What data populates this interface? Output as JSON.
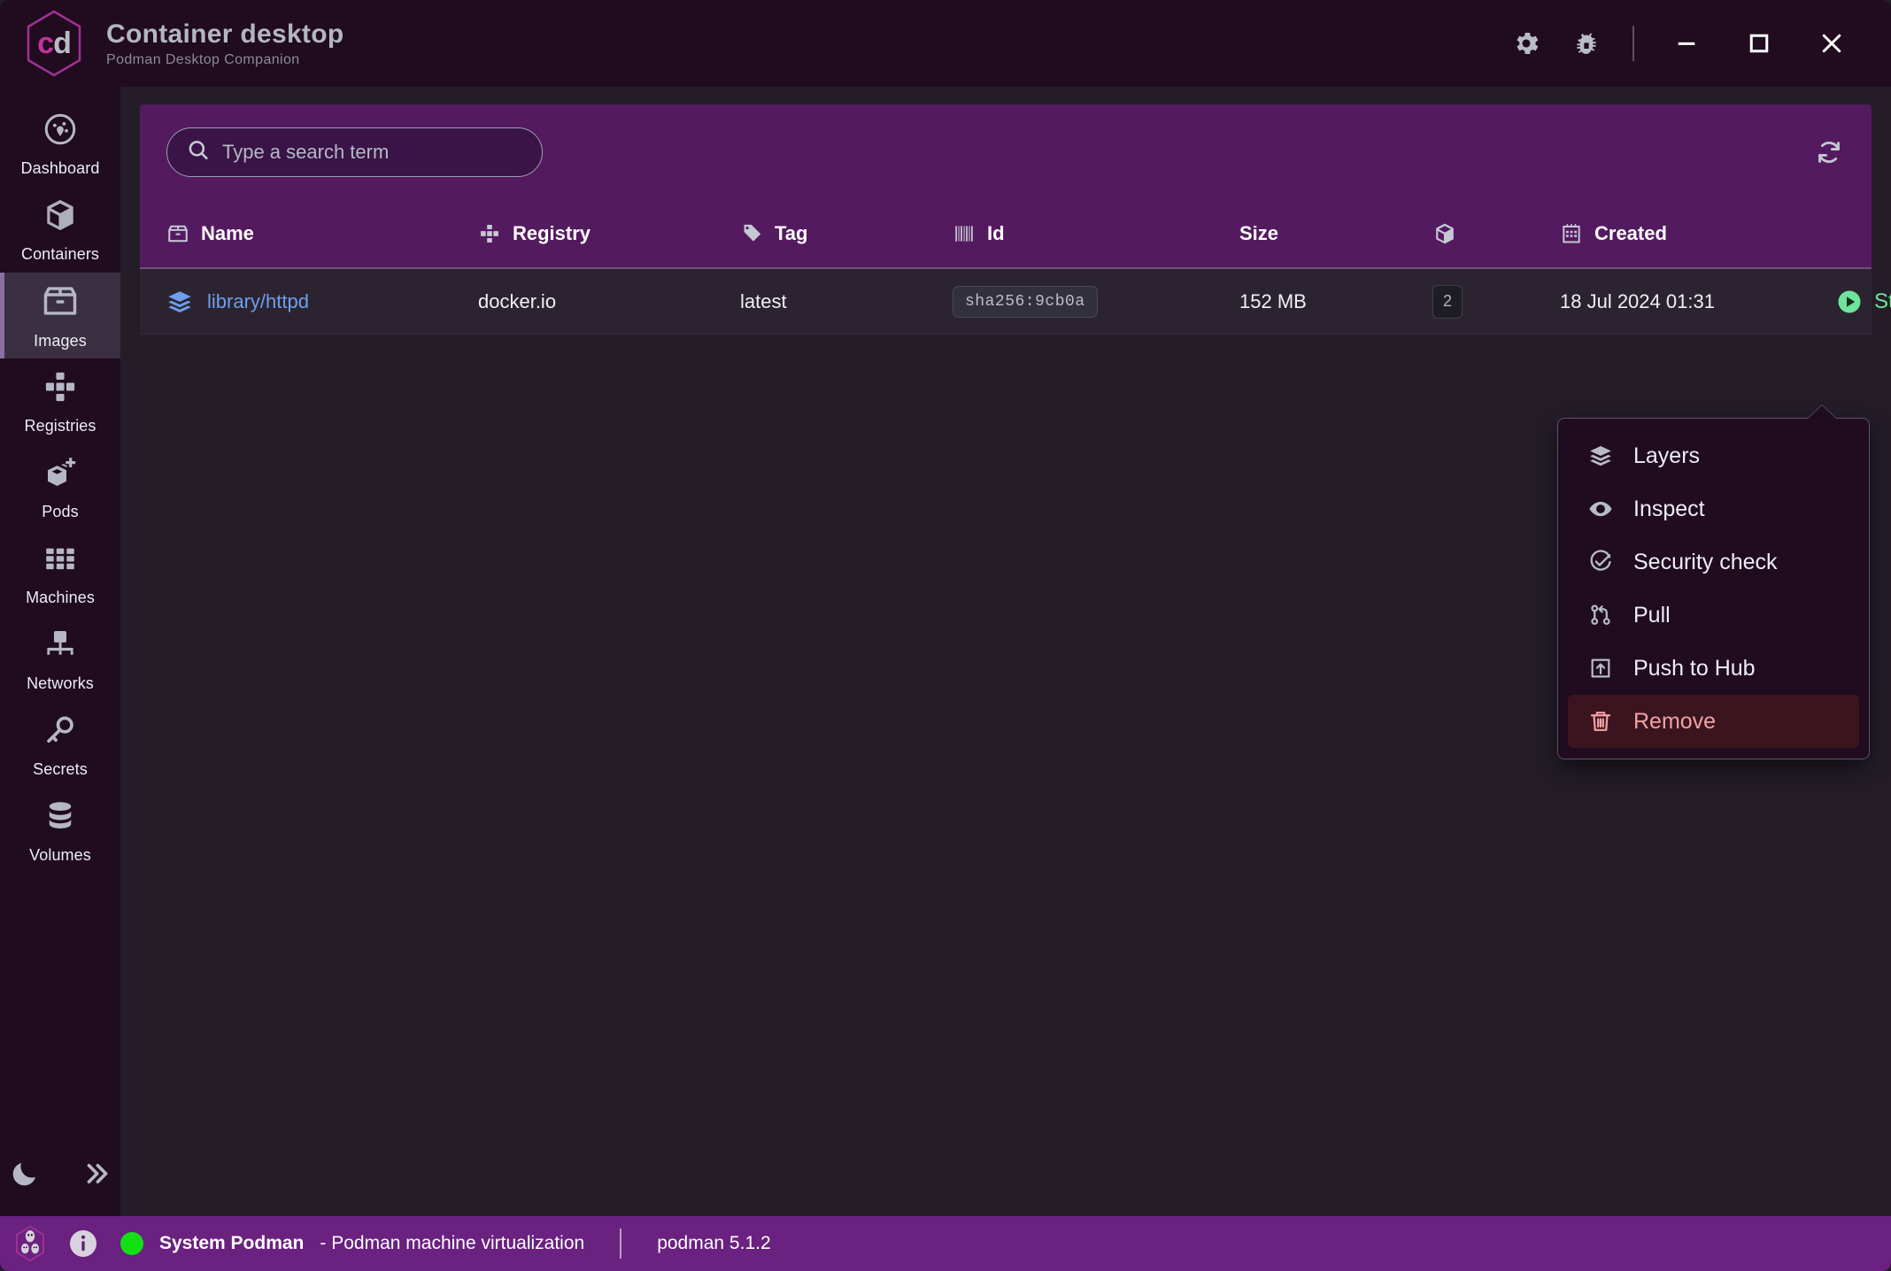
{
  "titlebar": {
    "logo_c": "c",
    "logo_d": "d",
    "title": "Container desktop",
    "subtitle": "Podman Desktop Companion",
    "buttons": [
      {
        "name": "settings",
        "icon": "gear-icon"
      },
      {
        "name": "troubleshoot",
        "icon": "bug-icon"
      }
    ],
    "window_controls": [
      {
        "name": "minimize",
        "icon": "minimize-icon"
      },
      {
        "name": "maximize",
        "icon": "maximize-icon"
      },
      {
        "name": "close",
        "icon": "close-icon"
      }
    ]
  },
  "sidebar": {
    "items": [
      {
        "label": "Dashboard",
        "icon": "gauge-icon",
        "active": false
      },
      {
        "label": "Containers",
        "icon": "cube-icon",
        "active": false
      },
      {
        "label": "Images",
        "icon": "box-icon",
        "active": true
      },
      {
        "label": "Registries",
        "icon": "registry-icon",
        "active": false
      },
      {
        "label": "Pods",
        "icon": "pods-icon",
        "active": false
      },
      {
        "label": "Machines",
        "icon": "machines-icon",
        "active": false
      },
      {
        "label": "Networks",
        "icon": "network-icon",
        "active": false
      },
      {
        "label": "Secrets",
        "icon": "key-icon",
        "active": false
      },
      {
        "label": "Volumes",
        "icon": "database-icon",
        "active": false
      }
    ],
    "bottom": [
      {
        "name": "theme-toggle",
        "icon": "moon-icon"
      },
      {
        "name": "expand-sidebar",
        "icon": "double-chevron-right-icon"
      }
    ]
  },
  "search": {
    "placeholder": "Type a search term",
    "value": "",
    "icon": "search-icon"
  },
  "toolbar": {
    "refresh_icon": "refresh-icon"
  },
  "table": {
    "columns": [
      {
        "label": "Name",
        "icon": "box-icon"
      },
      {
        "label": "Registry",
        "icon": "registry-icon"
      },
      {
        "label": "Tag",
        "icon": "tag-icon"
      },
      {
        "label": "Id",
        "icon": "barcode-icon"
      },
      {
        "label": "Size",
        "icon": ""
      },
      {
        "label": "",
        "icon": "cube-icon"
      },
      {
        "label": "Created",
        "icon": "calendar-icon"
      }
    ],
    "rows": [
      {
        "name": "library/httpd",
        "name_icon": "layers-icon",
        "registry": "docker.io",
        "tag": "latest",
        "id": "sha256:9cb0a",
        "size": "152 MB",
        "count": "2",
        "created": "18 Jul 2024 01:31",
        "start_label": "Start",
        "start_icon": "play-icon",
        "kebab_icon": "kebab-icon"
      }
    ]
  },
  "dropdown": {
    "items": [
      {
        "label": "Layers",
        "icon": "layers-icon",
        "danger": false
      },
      {
        "label": "Inspect",
        "icon": "eye-icon",
        "danger": false
      },
      {
        "label": "Security check",
        "icon": "shield-check-icon",
        "danger": false
      },
      {
        "label": "Pull",
        "icon": "git-pull-icon",
        "danger": false
      },
      {
        "label": "Push to Hub",
        "icon": "push-icon",
        "danger": false
      },
      {
        "label": "Remove",
        "icon": "trash-icon",
        "danger": true
      }
    ]
  },
  "statusbar": {
    "podman_logo_icon": "podman-logo-icon",
    "info_icon": "info-icon",
    "connection_name": "System Podman",
    "connection_desc": "- Podman machine virtualization",
    "version": "podman 5.1.2",
    "status_color": "#12e012"
  },
  "colors": {
    "accent_purple": "#541a60",
    "status_purple": "#6a2180",
    "sidebar_bg": "#200b1f",
    "content_bg": "#241d28",
    "row_bg": "#2b2430",
    "link_blue": "#6f9ef0",
    "start_green": "#6ee59a",
    "danger_red": "#f2a1a4"
  }
}
